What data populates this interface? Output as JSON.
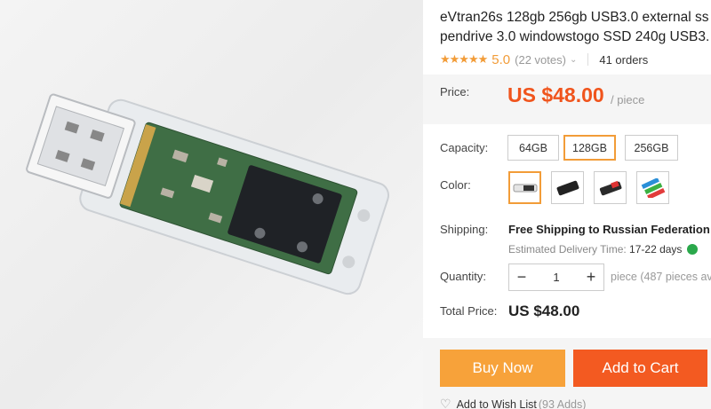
{
  "product": {
    "title_line1": "eVtran26s 128gb 256gb USB3.0 external ss",
    "title_line2": "pendrive 3.0 windowstogo SSD 240g USB3.",
    "stars": "★★★★★",
    "rating": "5.0",
    "votes": "(22 votes)",
    "orders": "41 orders",
    "image_icon": "usb-flash-drive"
  },
  "price": {
    "label": "Price:",
    "value": "US $48.00",
    "unit": "/ piece"
  },
  "capacity": {
    "label": "Capacity:",
    "options": [
      "64GB",
      "128GB",
      "256GB"
    ],
    "selected": "128GB"
  },
  "color": {
    "label": "Color:",
    "swatches": [
      "clear-usb-drive",
      "black-usb-drive",
      "red-black-usb-drive",
      "multicolor-usb-drives"
    ]
  },
  "shipping": {
    "label": "Shipping:",
    "method": "Free Shipping to Russian Federation",
    "estimate_label": "Estimated Delivery Time:",
    "estimate_days": "17-22 days"
  },
  "quantity": {
    "label": "Quantity:",
    "minus": "−",
    "value": "1",
    "plus": "+",
    "note": "piece (487 pieces av"
  },
  "total": {
    "label": "Total Price:",
    "value": "US $48.00"
  },
  "actions": {
    "buy_now": "Buy Now",
    "add_to_cart": "Add to Cart",
    "wish_label": "Add to Wish List",
    "wish_count": "(93 Adds)"
  },
  "colors": {
    "accent_orange": "#f29c38",
    "price_red": "#f0541c",
    "buy_now_bg": "#f7a23a",
    "add_to_cart_bg": "#f35a21"
  }
}
